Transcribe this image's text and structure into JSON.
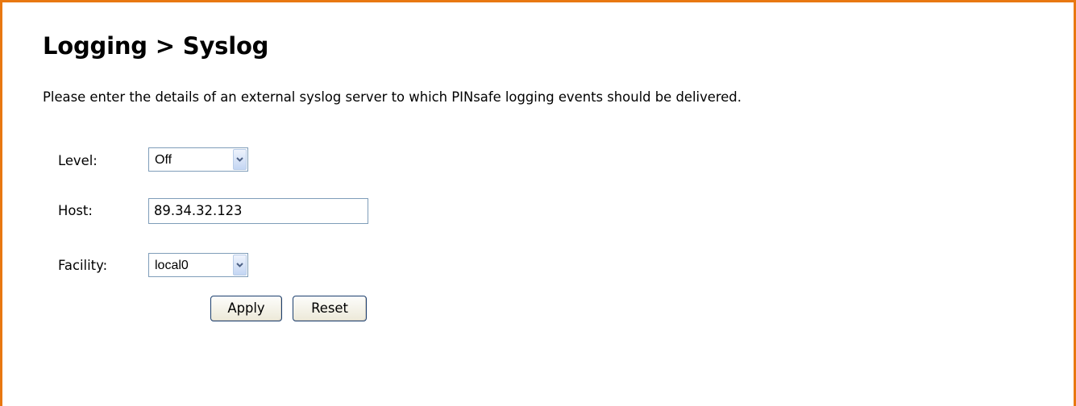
{
  "page": {
    "title": "Logging > Syslog",
    "intro": "Please enter the details of an external syslog server to which PINsafe logging events should be delivered."
  },
  "form": {
    "level": {
      "label": "Level:",
      "value": "Off"
    },
    "host": {
      "label": "Host:",
      "value": "89.34.32.123"
    },
    "facility": {
      "label": "Facility:",
      "value": "local0"
    },
    "apply_label": "Apply",
    "reset_label": "Reset"
  },
  "colors": {
    "frame_border": "#e87811",
    "input_border": "#7f9db9",
    "button_border": "#1c3f6e"
  },
  "icons": {
    "dropdown": "chevron-down-icon"
  }
}
